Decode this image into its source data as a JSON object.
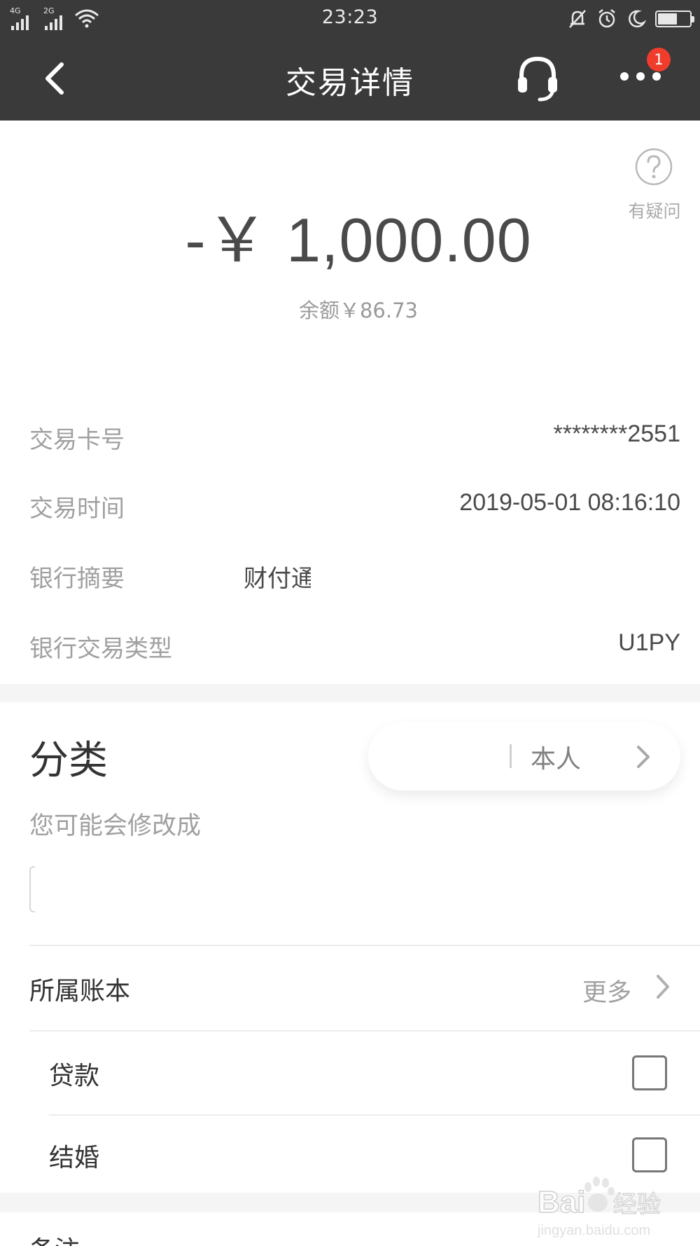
{
  "status_bar": {
    "network_1": "4G",
    "network_2": "2G",
    "time": "23:23"
  },
  "nav": {
    "title": "交易详情",
    "badge_count": "1"
  },
  "amount": {
    "value": "-￥ 1,000.00",
    "balance": "余额￥86.73"
  },
  "help": {
    "label": "有疑问"
  },
  "details": [
    {
      "label": "交易卡号",
      "value": "********2551"
    },
    {
      "label": "交易时间",
      "value": "2019-05-01 08:16:10"
    },
    {
      "label": "银行摘要",
      "value": "财付通"
    },
    {
      "label": "银行交易类型",
      "value": "U1PY"
    }
  ],
  "category": {
    "title": "分类",
    "value": "本人",
    "suggest_label": "您可能会修改成"
  },
  "ledger": {
    "title": "所属账本",
    "more": "更多",
    "items": [
      {
        "label": "贷款",
        "checked": false
      },
      {
        "label": "结婚",
        "checked": false
      }
    ]
  },
  "remark": {
    "label": "备注"
  },
  "watermark": {
    "brand": "Baidu经验",
    "url": "jingyan.baidu.com"
  },
  "colors": {
    "header_bg": "#3a3a3a",
    "badge": "#f03c2c",
    "amount_text": "#4a4a4a",
    "muted_text": "#a0a0a0"
  }
}
